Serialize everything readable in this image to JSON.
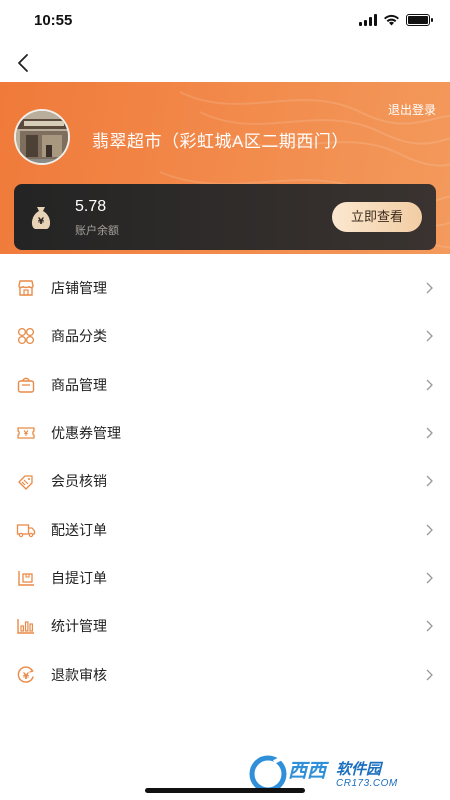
{
  "status_bar": {
    "time": "10:55",
    "icons": [
      "signal-icon",
      "wifi-icon",
      "battery-icon"
    ]
  },
  "nav": {
    "back_icon": "chevron-left-icon"
  },
  "header": {
    "store_name": "翡翠超市（彩虹城A区二期西门）",
    "logout_label": "退出登录",
    "accent_color": "#f07a3a"
  },
  "balance": {
    "amount": "5.78",
    "label": "账户余额",
    "button_label": "立即查看",
    "icon": "money-bag-icon"
  },
  "menu": {
    "items": [
      {
        "label": "店铺管理",
        "icon": "store-icon"
      },
      {
        "label": "商品分类",
        "icon": "category-icon"
      },
      {
        "label": "商品管理",
        "icon": "goods-icon"
      },
      {
        "label": "优惠券管理",
        "icon": "coupon-icon"
      },
      {
        "label": "会员核销",
        "icon": "member-verify-icon"
      },
      {
        "label": "配送订单",
        "icon": "delivery-truck-icon"
      },
      {
        "label": "自提订单",
        "icon": "pickup-icon"
      },
      {
        "label": "统计管理",
        "icon": "bar-chart-icon"
      },
      {
        "label": "退款审核",
        "icon": "refund-icon"
      }
    ]
  },
  "watermark": {
    "brand": "西西",
    "sub": "软件园",
    "url": "CR173.COM"
  }
}
